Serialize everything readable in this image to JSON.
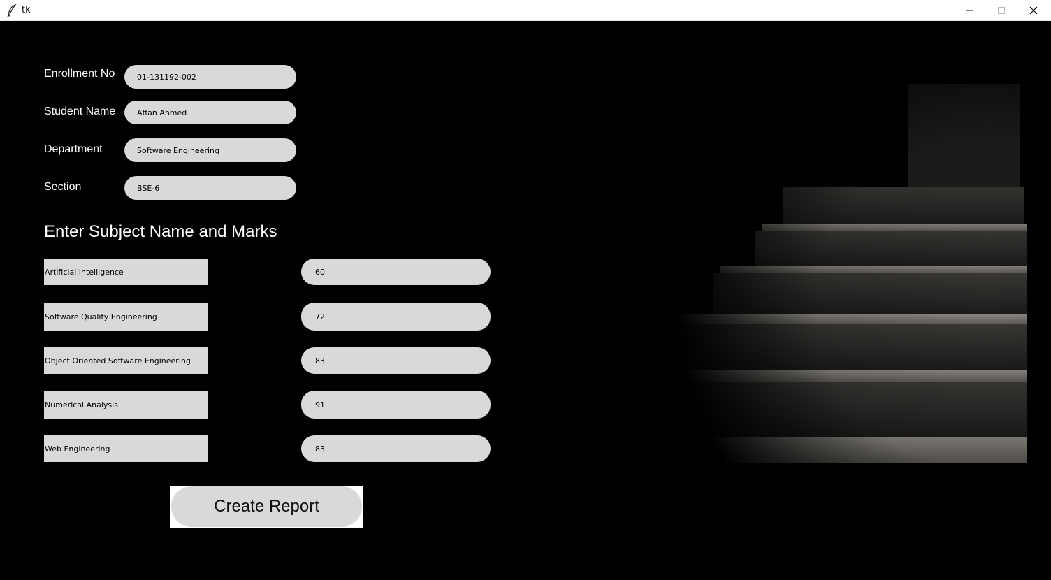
{
  "window": {
    "title": "tk"
  },
  "form": {
    "enrollment": {
      "label": "Enrollment No",
      "value": "01-131192-002"
    },
    "student_name": {
      "label": "Student Name",
      "value": "Affan Ahmed"
    },
    "department": {
      "label": "Department",
      "value": "Software Engineering"
    },
    "section": {
      "label": "Section",
      "value": "BSE-6"
    }
  },
  "subjects_heading": "Enter Subject Name and Marks",
  "subjects": [
    {
      "name": "Artificial Intelligence",
      "marks": "60"
    },
    {
      "name": "Software Quality Engineering",
      "marks": "72"
    },
    {
      "name": "Object Oriented Software Engineering",
      "marks": "83"
    },
    {
      "name": "Numerical Analysis",
      "marks": "91"
    },
    {
      "name": "Web Engineering",
      "marks": "83"
    }
  ],
  "create_report_label": "Create Report",
  "colors": {
    "background": "#000000",
    "field": "#d9d9d9",
    "text": "#ffffff"
  }
}
